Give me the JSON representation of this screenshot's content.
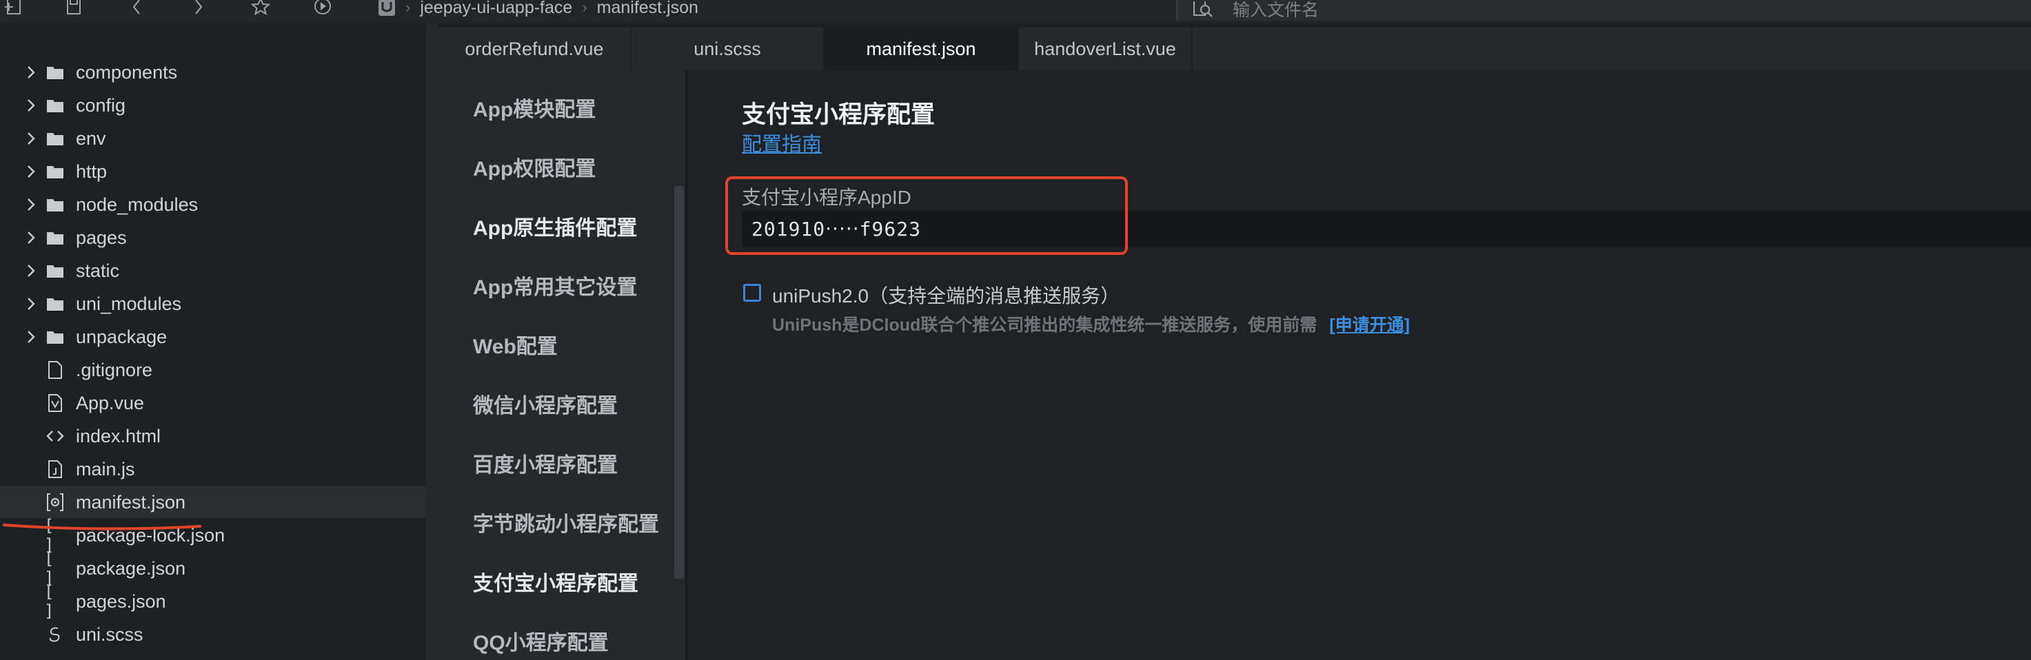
{
  "breadcrumb": {
    "project": "jeepay-ui-uapp-face",
    "file": "manifest.json"
  },
  "file_search": {
    "placeholder": "输入文件名"
  },
  "sidebar": {
    "items": [
      {
        "label": "components",
        "type": "folder"
      },
      {
        "label": "config",
        "type": "folder"
      },
      {
        "label": "env",
        "type": "folder"
      },
      {
        "label": "http",
        "type": "folder"
      },
      {
        "label": "node_modules",
        "type": "folder"
      },
      {
        "label": "pages",
        "type": "folder"
      },
      {
        "label": "static",
        "type": "folder"
      },
      {
        "label": "uni_modules",
        "type": "folder"
      },
      {
        "label": "unpackage",
        "type": "folder"
      },
      {
        "label": ".gitignore",
        "type": "file"
      },
      {
        "label": "App.vue",
        "type": "vue"
      },
      {
        "label": "index.html",
        "type": "html"
      },
      {
        "label": "main.js",
        "type": "js"
      },
      {
        "label": "manifest.json",
        "type": "manifest",
        "active": true
      },
      {
        "label": "package-lock.json",
        "type": "json"
      },
      {
        "label": "package.json",
        "type": "json"
      },
      {
        "label": "pages.json",
        "type": "json"
      },
      {
        "label": "uni.scss",
        "type": "scss"
      }
    ]
  },
  "tabs": [
    {
      "label": "orderRefund.vue"
    },
    {
      "label": "uni.scss"
    },
    {
      "label": "manifest.json",
      "active": true
    },
    {
      "label": "handoverList.vue"
    }
  ],
  "manifest_nav": {
    "items": [
      "App模块配置",
      "App权限配置",
      "App原生插件配置",
      "App常用其它设置",
      "Web配置",
      "微信小程序配置",
      "百度小程序配置",
      "字节跳动小程序配置",
      "支付宝小程序配置",
      "QQ小程序配置"
    ]
  },
  "main": {
    "title": "支付宝小程序配置",
    "guide_link": "配置指南",
    "appid_label": "支付宝小程序AppID",
    "appid_value": "201910‧‧‧‧‧f9623",
    "unipush": {
      "checked": false,
      "label": "uniPush2.0（支持全端的消息推送服务）",
      "description": "UniPush是DCloud联合个推公司推出的集成性统一推送服务，使用前需",
      "link": "[申请开通]"
    }
  },
  "colors": {
    "accent_link": "#3b8fe0",
    "highlight": "#e0452c",
    "active_tab_bg": "#1b1d20"
  }
}
